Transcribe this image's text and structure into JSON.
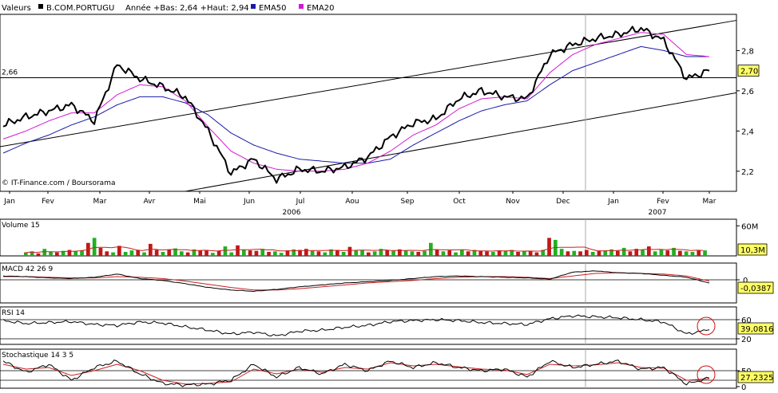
{
  "header": {
    "valeurs_label": "Valeurs",
    "symbol": "B.COM.PORTUGU",
    "range_text": "Année +Bas: 2,64 +Haut: 2,94",
    "ema50_label": "EMA50",
    "ema20_label": "EMA20"
  },
  "credit": "© IT-Finance.com / Boursorama",
  "colors": {
    "price": "#000000",
    "ema50": "#1a1aa8",
    "ema20": "#d21ad2",
    "vol_up": "#22b022",
    "vol_down": "#c01818",
    "signal": "#cc2020",
    "badge": "#ffff66",
    "circle": "#d01010"
  },
  "icons": {
    "legend_marker": "color-square"
  },
  "chart_data": [
    {
      "type": "line",
      "title": "B.COM.PORTUGU",
      "subtitle": "Année +Bas: 2,64 +Haut: 2,94",
      "x": [
        "Jan",
        "Jan",
        "Feb",
        "Feb",
        "Mar",
        "Mar",
        "Mar",
        "Apr",
        "Apr",
        "May",
        "May",
        "May",
        "Jun",
        "Jun",
        "Jul",
        "Jul",
        "Aug",
        "Aug",
        "Sep",
        "Sep",
        "Oct",
        "Oct",
        "Nov",
        "Nov",
        "Dec",
        "Dec",
        "Jan",
        "Jan",
        "Feb",
        "Feb",
        "Mar",
        "Mar"
      ],
      "series": [
        {
          "name": "B.COM.PORTUGU",
          "values": [
            2.43,
            2.47,
            2.5,
            2.53,
            2.45,
            2.73,
            2.66,
            2.62,
            2.57,
            2.4,
            2.19,
            2.26,
            2.16,
            2.21,
            2.2,
            2.22,
            2.27,
            2.37,
            2.44,
            2.46,
            2.56,
            2.6,
            2.57,
            2.56,
            2.78,
            2.83,
            2.86,
            2.88,
            2.91,
            2.85,
            2.66,
            2.7
          ]
        },
        {
          "name": "EMA50",
          "values": [
            2.29,
            2.34,
            2.38,
            2.43,
            2.47,
            2.53,
            2.57,
            2.57,
            2.54,
            2.48,
            2.39,
            2.33,
            2.29,
            2.26,
            2.25,
            2.24,
            2.24,
            2.26,
            2.33,
            2.39,
            2.45,
            2.5,
            2.53,
            2.55,
            2.63,
            2.7,
            2.74,
            2.78,
            2.82,
            2.8,
            2.77,
            2.77
          ]
        },
        {
          "name": "EMA20",
          "values": [
            2.36,
            2.4,
            2.45,
            2.49,
            2.49,
            2.58,
            2.63,
            2.62,
            2.55,
            2.42,
            2.3,
            2.24,
            2.21,
            2.2,
            2.2,
            2.21,
            2.24,
            2.3,
            2.38,
            2.43,
            2.51,
            2.56,
            2.57,
            2.56,
            2.69,
            2.78,
            2.83,
            2.86,
            2.89,
            2.88,
            2.78,
            2.77
          ]
        }
      ],
      "ylim": [
        2.1,
        2.98
      ],
      "yticks": [
        "2,2",
        "2,4",
        "2,6",
        "2,8"
      ],
      "xticks": [
        "Jan",
        "Fev",
        "Mar",
        "Avr",
        "Mai",
        "Jun",
        "Jul",
        "Aou",
        "Sep",
        "Oct",
        "Nov",
        "Dec",
        "Jan",
        "Fev",
        "Mar"
      ],
      "year_labels": [
        "2006",
        "2007"
      ],
      "reference_label": "2,66",
      "last_value": "2,70",
      "grid": false
    },
    {
      "type": "bar",
      "title": "Volume 15",
      "yticks": [
        "60M",
        "0"
      ],
      "ylim": [
        0,
        70
      ],
      "last_value": "10,3M",
      "values": [
        6,
        9,
        5,
        14,
        8,
        7,
        10,
        12,
        9,
        11,
        26,
        36,
        16,
        9,
        7,
        20,
        8,
        11,
        12,
        7,
        24,
        12,
        8,
        12,
        15,
        9,
        7,
        13,
        11,
        12,
        6,
        10,
        19,
        7,
        21,
        12,
        11,
        10,
        14,
        8,
        9,
        6,
        11,
        13,
        12,
        14,
        10,
        9,
        7,
        13,
        12,
        8,
        18,
        11,
        12,
        7,
        9,
        14,
        12,
        10,
        13,
        11,
        9,
        8,
        10,
        26,
        12,
        9,
        11,
        7,
        12,
        9,
        12,
        10,
        9,
        8,
        11,
        10,
        12,
        8,
        9,
        10,
        7,
        12,
        36,
        32,
        14,
        9,
        10,
        9,
        12,
        8,
        10,
        11,
        13,
        10,
        16,
        9,
        14,
        12,
        19,
        9,
        13,
        11,
        16,
        10,
        9,
        8,
        12,
        11
      ]
    },
    {
      "type": "line",
      "title": "MACD 42 26 9",
      "yticks": [
        "0"
      ],
      "last_value": "-0,0387",
      "series": [
        {
          "values": [
            0.06,
            0.05,
            0.03,
            0.02,
            0.04,
            0.09,
            0.02,
            -0.01,
            -0.06,
            -0.12,
            -0.16,
            -0.18,
            -0.15,
            -0.11,
            -0.08,
            -0.05,
            -0.03,
            -0.01,
            0.02,
            0.05,
            0.06,
            0.05,
            0.04,
            0.03,
            0.01,
            0.12,
            0.14,
            0.11,
            0.1,
            0.07,
            0.04,
            -0.05
          ]
        },
        {
          "values": [
            0.05,
            0.05,
            0.04,
            0.03,
            0.03,
            0.05,
            0.04,
            0.02,
            -0.02,
            -0.07,
            -0.12,
            -0.16,
            -0.16,
            -0.14,
            -0.11,
            -0.08,
            -0.05,
            -0.03,
            -0.01,
            0.02,
            0.04,
            0.05,
            0.05,
            0.04,
            0.02,
            0.06,
            0.1,
            0.11,
            0.1,
            0.09,
            0.06,
            -0.02
          ]
        }
      ]
    },
    {
      "type": "line",
      "title": "RSI 14",
      "yticks": [
        "60",
        "20"
      ],
      "ylim": [
        0,
        100
      ],
      "last_value": "39,0816",
      "values": [
        58,
        52,
        54,
        56,
        50,
        48,
        55,
        53,
        45,
        38,
        30,
        34,
        26,
        36,
        38,
        44,
        48,
        56,
        58,
        60,
        58,
        54,
        52,
        50,
        62,
        68,
        66,
        64,
        60,
        55,
        30,
        39
      ]
    },
    {
      "type": "line",
      "title": "Stochastique 14 3 5",
      "yticks": [
        "50",
        "0"
      ],
      "ylim": [
        0,
        100
      ],
      "last_value": "27,2325",
      "series": [
        {
          "values": [
            80,
            45,
            70,
            20,
            60,
            80,
            40,
            10,
            5,
            8,
            20,
            70,
            30,
            60,
            40,
            70,
            50,
            80,
            60,
            75,
            60,
            50,
            55,
            30,
            80,
            60,
            70,
            80,
            55,
            60,
            8,
            27
          ]
        },
        {
          "values": [
            70,
            55,
            60,
            35,
            50,
            70,
            50,
            20,
            8,
            10,
            15,
            55,
            40,
            55,
            45,
            60,
            55,
            75,
            65,
            70,
            62,
            55,
            52,
            38,
            70,
            65,
            68,
            75,
            60,
            58,
            20,
            25
          ]
        }
      ]
    }
  ]
}
